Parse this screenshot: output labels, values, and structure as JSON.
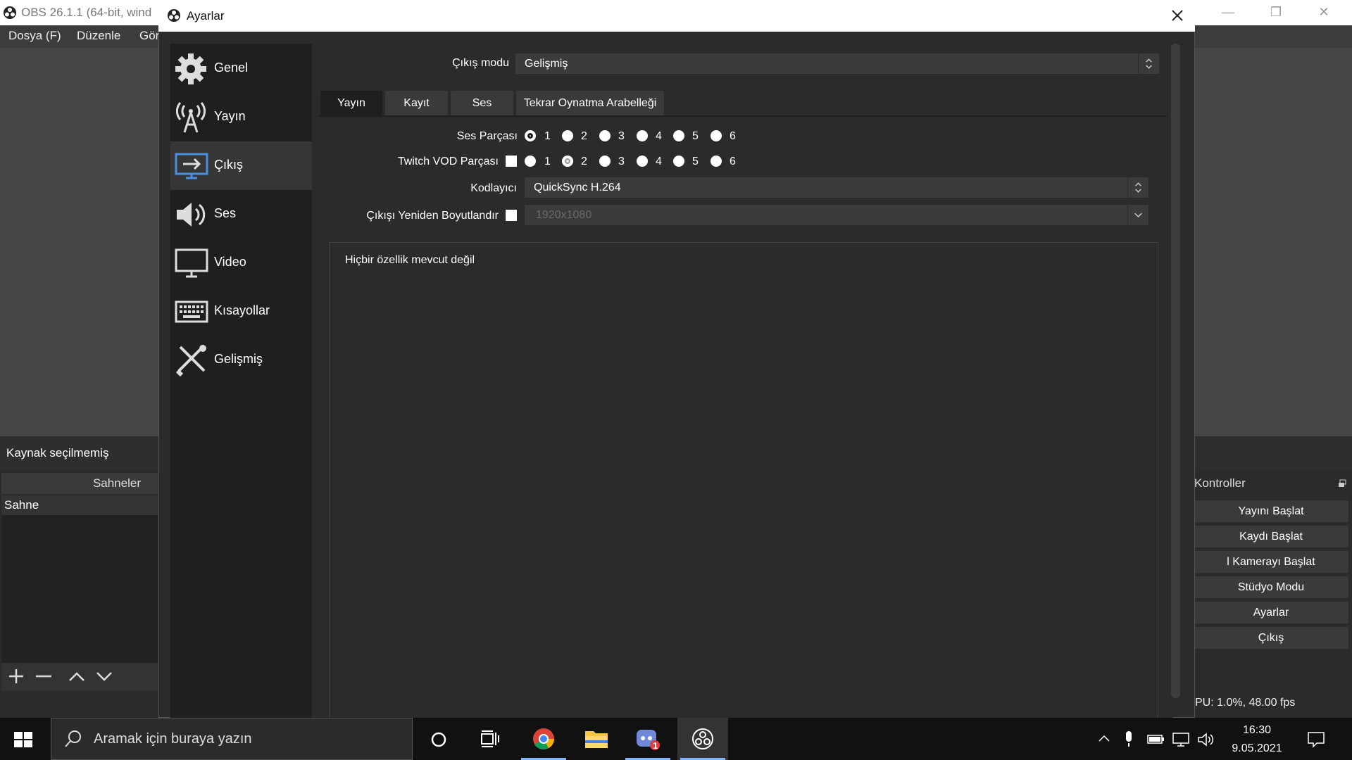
{
  "main_window": {
    "title": "OBS 26.1.1 (64-bit, wind",
    "menu": [
      "Dosya (F)",
      "Düzenle",
      "Gör"
    ],
    "source_status": "Kaynak seçilmemiş",
    "scenes_header": "Sahneler",
    "scene_item": "Sahne",
    "controls_header": "Kontroller",
    "controls": [
      "Yayını Başlat",
      "Kaydı Başlat",
      "l Kamerayı Başlat",
      "Stüdyo Modu",
      "Ayarlar",
      "Çıkış"
    ],
    "stats": "PU: 1.0%, 48.00 fps"
  },
  "dialog": {
    "title": "Ayarlar",
    "nav": [
      {
        "label": "Genel",
        "icon": "gear-icon"
      },
      {
        "label": "Yayın",
        "icon": "broadcast-tower-icon"
      },
      {
        "label": "Çıkış",
        "icon": "output-monitor-icon"
      },
      {
        "label": "Ses",
        "icon": "speaker-icon"
      },
      {
        "label": "Video",
        "icon": "monitor-icon"
      },
      {
        "label": "Kısayollar",
        "icon": "keyboard-icon"
      },
      {
        "label": "Gelişmiş",
        "icon": "tools-icon"
      }
    ],
    "active_nav": "Çıkış",
    "output_mode_label": "Çıkış modu",
    "output_mode_value": "Gelişmiş",
    "tabs": [
      "Yayın",
      "Kayıt",
      "Ses",
      "Tekrar Oynatma Arabelleği"
    ],
    "active_tab": "Yayın",
    "audio_track_label": "Ses Parçası",
    "audio_track_options": [
      "1",
      "2",
      "3",
      "4",
      "5",
      "6"
    ],
    "audio_track_selected": "1",
    "twitch_vod_label": "Twitch VOD Parçası",
    "twitch_vod_options": [
      "1",
      "2",
      "3",
      "4",
      "5",
      "6"
    ],
    "twitch_vod_selected": "2",
    "encoder_label": "Kodlayıcı",
    "encoder_value": "QuickSync H.264",
    "rescale_label": "Çıkışı Yeniden Boyutlandır",
    "rescale_value": "1920x1080",
    "properties_empty": "Hiçbir özellik mevcut değil"
  },
  "taskbar": {
    "search_placeholder": "Aramak için buraya yazın",
    "discord_badge": "1",
    "time": "16:30",
    "date": "9.05.2021"
  }
}
